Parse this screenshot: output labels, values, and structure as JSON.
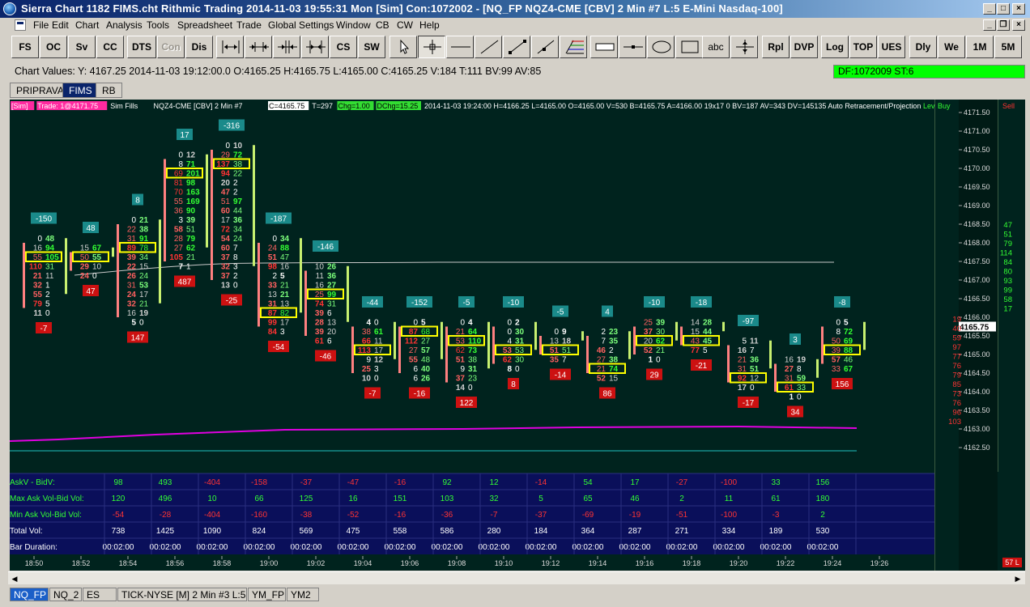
{
  "window": {
    "title": "Sierra Chart 1182 FIMS.cht  Rithmic Trading 2014-11-03  19:55:31 Mon [Sim]  Con:1072002 - [NQ_FP  NQZ4-CME [CBV]  2 Min   #7  L:5  E-Mini Nasdaq-100]",
    "minimize": "_",
    "maximize": "□",
    "close": "×",
    "restore": "❐"
  },
  "menu": [
    "File",
    "Edit",
    "Chart",
    "Analysis",
    "Tools",
    "Spreadsheet",
    "Trade",
    "Global Settings",
    "Window",
    "CB",
    "CW",
    "Help"
  ],
  "toolbar": {
    "buttons_left": [
      "FS",
      "OC",
      "Sv",
      "CC",
      "DTS",
      "Con",
      "Dis"
    ],
    "buttons_mid": [
      "CS",
      "SW"
    ],
    "text_tool": "abc",
    "buttons_right": [
      "Rpl",
      "DVP",
      "Log",
      "TOP",
      "UES",
      "Dly",
      "We",
      "1M",
      "5M"
    ],
    "icons": [
      "cursor-arrow-icon",
      "crosshair-icon",
      "horizontal-line-icon",
      "ray-icon",
      "line-icon",
      "extension-line-icon",
      "fibonacci-icon",
      "rectangle-highlight-icon",
      "marker-line-icon",
      "ellipse-icon",
      "rectangle-icon",
      "vertical-split-icon"
    ]
  },
  "values_bar": {
    "text": "Chart Values: Y: 4167.25  2014-11-03  19:12:00.0  O:4165.25  H:4165.75  L:4165.00  C:4165.25  V:184  T:111  BV:99  AV:85",
    "df_status": "DF:1072009  ST:6"
  },
  "chart_tabs": [
    {
      "label": "PRIPRAVA",
      "active": false
    },
    {
      "label": "FIMS",
      "active": true
    },
    {
      "label": "RB",
      "active": false
    }
  ],
  "chart_header": {
    "sim": "[Sim]",
    "trade": "Trade: 1@4171.75",
    "sim_fills": "Sim Fills",
    "symbol": "NQZ4-CME [CBV]  2 Min   #7",
    "close_val": "C=4165.75",
    "t_val": "T=297",
    "chg": "Chg=1.00",
    "dchg": "DChg=15.25",
    "info": "2014-11-03 19:24:00 H=4166.25 L=4165.00 O=4165.00 V=530 B=4165.75 A=4166.00 19x17 0 BV=187 AV=343 DV=145135  Auto Retracement/Projection",
    "lev": "Lev",
    "buy": "Buy",
    "sell": "Sell"
  },
  "price_axis": {
    "labels": [
      "4171.50",
      "4171.00",
      "4170.50",
      "4170.00",
      "4169.50",
      "4169.00",
      "4168.50",
      "4168.00",
      "4167.50",
      "4167.00",
      "4166.50",
      "4166.00",
      "4165.50",
      "4165.00",
      "4164.50",
      "4164.00",
      "4163.50",
      "4163.00",
      "4162.50"
    ],
    "current": "4165.75"
  },
  "time_axis": [
    "18:50",
    "18:52",
    "18:54",
    "18:56",
    "18:58",
    "19:00",
    "19:02",
    "19:04",
    "19:06",
    "19:08",
    "19:10",
    "19:12",
    "19:14",
    "19:16",
    "19:18",
    "19:20",
    "19:22",
    "19:24",
    "19:26"
  ],
  "dom": {
    "sell": [
      "19",
      "40",
      "59",
      "97",
      "77",
      "76",
      "79",
      "85",
      "73",
      "76",
      "96",
      "103"
    ],
    "buy": [
      "47",
      "51",
      "79",
      "114",
      "84",
      "80",
      "93",
      "99",
      "58",
      "17"
    ]
  },
  "footprint_bars": [
    {
      "delta_top": "-150",
      "delta_bottom": "-7",
      "rows": [
        [
          "0",
          "48"
        ],
        [
          "16",
          "94"
        ],
        [
          "55",
          "105"
        ],
        [
          "110",
          "31"
        ],
        [
          "21",
          "11"
        ],
        [
          "32",
          "1"
        ],
        [
          "55",
          "2"
        ],
        [
          "79",
          "5"
        ],
        [
          "11",
          "0"
        ]
      ]
    },
    {
      "delta_top": "48",
      "delta_bottom": "47",
      "rows": [
        [
          "15",
          "67"
        ],
        [
          "50",
          "55"
        ],
        [
          "29",
          "10"
        ],
        [
          "24",
          "0"
        ]
      ]
    },
    {
      "delta_top": "8",
      "delta_bottom": "147",
      "rows": [
        [
          "0",
          "21"
        ],
        [
          "22",
          "38"
        ],
        [
          "31",
          "91"
        ],
        [
          "89",
          "78"
        ],
        [
          "39",
          "34"
        ],
        [
          "22",
          "15"
        ],
        [
          "26",
          "24"
        ],
        [
          "31",
          "53"
        ],
        [
          "24",
          "17"
        ],
        [
          "32",
          "21"
        ],
        [
          "16",
          "19"
        ],
        [
          "5",
          "0"
        ]
      ]
    },
    {
      "delta_top": "17",
      "delta_bottom": "487",
      "rows": [
        [
          "0",
          "12"
        ],
        [
          "8",
          "71"
        ],
        [
          "69",
          "201"
        ],
        [
          "81",
          "98"
        ],
        [
          "70",
          "163"
        ],
        [
          "55",
          "169"
        ],
        [
          "36",
          "90"
        ],
        [
          "3",
          "39"
        ],
        [
          "58",
          "51"
        ],
        [
          "28",
          "79"
        ],
        [
          "27",
          "62"
        ],
        [
          "105",
          "21"
        ],
        [
          "7",
          "1"
        ]
      ]
    },
    {
      "delta_top": "-316",
      "delta_bottom": "-25",
      "rows": [
        [
          "0",
          "10"
        ],
        [
          "29",
          "72"
        ],
        [
          "137",
          "38"
        ],
        [
          "94",
          "22"
        ],
        [
          "20",
          "2"
        ],
        [
          "47",
          "2"
        ],
        [
          "51",
          "97"
        ],
        [
          "60",
          "44"
        ],
        [
          "17",
          "36"
        ],
        [
          "72",
          "34"
        ],
        [
          "54",
          "24"
        ],
        [
          "60",
          "7"
        ],
        [
          "37",
          "8"
        ],
        [
          "32",
          "3"
        ],
        [
          "37",
          "2"
        ],
        [
          "13",
          "0"
        ]
      ]
    },
    {
      "delta_top": "-187",
      "delta_bottom": "-54",
      "rows": [
        [
          "0",
          "34"
        ],
        [
          "24",
          "88"
        ],
        [
          "51",
          "47"
        ],
        [
          "98",
          "16"
        ],
        [
          "2",
          "5"
        ],
        [
          "33",
          "21"
        ],
        [
          "13",
          "21"
        ],
        [
          "31",
          "13"
        ],
        [
          "87",
          "82"
        ],
        [
          "99",
          "17"
        ],
        [
          "84",
          "3"
        ]
      ]
    },
    {
      "delta_top": "-146",
      "delta_bottom": "-46",
      "rows": [
        [
          "10",
          "26"
        ],
        [
          "11",
          "36"
        ],
        [
          "16",
          "27"
        ],
        [
          "25",
          "99"
        ],
        [
          "74",
          "31"
        ],
        [
          "39",
          "6"
        ],
        [
          "28",
          "13"
        ],
        [
          "39",
          "20"
        ],
        [
          "61",
          "6"
        ]
      ]
    },
    {
      "delta_top": "-44",
      "delta_bottom": "-7",
      "rows": [
        [
          "4",
          "0"
        ],
        [
          "38",
          "61"
        ],
        [
          "66",
          "11"
        ],
        [
          "113",
          "17"
        ],
        [
          "9",
          "12"
        ],
        [
          "25",
          "3"
        ],
        [
          "10",
          "0"
        ]
      ]
    },
    {
      "delta_top": "-152",
      "delta_bottom": "-16",
      "rows": [
        [
          "0",
          "5"
        ],
        [
          "87",
          "68"
        ],
        [
          "112",
          "27"
        ],
        [
          "27",
          "57"
        ],
        [
          "55",
          "48"
        ],
        [
          "6",
          "40"
        ],
        [
          "6",
          "26"
        ]
      ]
    },
    {
      "delta_top": "-5",
      "delta_bottom": "122",
      "rows": [
        [
          "0",
          "4"
        ],
        [
          "21",
          "64"
        ],
        [
          "53",
          "110"
        ],
        [
          "62",
          "73"
        ],
        [
          "51",
          "38"
        ],
        [
          "9",
          "31"
        ],
        [
          "37",
          "23"
        ],
        [
          "14",
          "0"
        ]
      ]
    },
    {
      "delta_top": "-10",
      "delta_bottom": "8",
      "rows": [
        [
          "0",
          "2"
        ],
        [
          "0",
          "30"
        ],
        [
          "4",
          "31"
        ],
        [
          "53",
          "53"
        ],
        [
          "62",
          "30"
        ],
        [
          "8",
          "0"
        ]
      ]
    },
    {
      "delta_top": "-5",
      "delta_bottom": "-14",
      "rows": [
        [
          "0",
          "9"
        ],
        [
          "13",
          "18"
        ],
        [
          "51",
          "51"
        ],
        [
          "35",
          "7"
        ]
      ]
    },
    {
      "delta_top": "4",
      "delta_bottom": "86",
      "rows": [
        [
          "2",
          "23"
        ],
        [
          "7",
          "35"
        ],
        [
          "46",
          "2"
        ],
        [
          "27",
          "38"
        ],
        [
          "21",
          "74"
        ],
        [
          "52",
          "15"
        ]
      ]
    },
    {
      "delta_top": "-10",
      "delta_bottom": "29",
      "rows": [
        [
          "25",
          "39"
        ],
        [
          "37",
          "30"
        ],
        [
          "20",
          "62"
        ],
        [
          "52",
          "21"
        ],
        [
          "1",
          "0"
        ]
      ]
    },
    {
      "delta_top": "-18",
      "delta_bottom": "-21",
      "rows": [
        [
          "14",
          "28"
        ],
        [
          "15",
          "44"
        ],
        [
          "43",
          "45"
        ],
        [
          "77",
          "5"
        ]
      ]
    },
    {
      "delta_top": "-97",
      "delta_bottom": "-17",
      "rows": [
        [
          "5",
          "11"
        ],
        [
          "16",
          "7"
        ],
        [
          "21",
          "36"
        ],
        [
          "31",
          "51"
        ],
        [
          "92",
          "12"
        ],
        [
          "17",
          "0"
        ]
      ]
    },
    {
      "delta_top": "3",
      "delta_bottom": "34",
      "rows": [
        [
          "16",
          "19"
        ],
        [
          "27",
          "8"
        ],
        [
          "31",
          "59"
        ],
        [
          "61",
          "33"
        ],
        [
          "1",
          "0"
        ]
      ]
    },
    {
      "delta_top": "-8",
      "delta_bottom": "156",
      "rows": [
        [
          "0",
          "5"
        ],
        [
          "8",
          "72"
        ],
        [
          "50",
          "69"
        ],
        [
          "39",
          "88"
        ],
        [
          "57",
          "46"
        ],
        [
          "33",
          "67"
        ]
      ]
    }
  ],
  "stats_table": {
    "rows": [
      {
        "label": "AskV - BidV:",
        "values": [
          "98",
          "493",
          "-404",
          "-158",
          "-37",
          "-47",
          "-16",
          "92",
          "12",
          "-14",
          "54",
          "17",
          "-27",
          "-100",
          "33",
          "156"
        ]
      },
      {
        "label": "Max Ask Vol-Bid Vol:",
        "values": [
          "120",
          "496",
          "10",
          "66",
          "125",
          "16",
          "151",
          "103",
          "32",
          "5",
          "65",
          "46",
          "2",
          "11",
          "61",
          "180"
        ]
      },
      {
        "label": "Min Ask Vol-Bid Vol:",
        "values": [
          "-54",
          "-28",
          "-404",
          "-160",
          "-38",
          "-52",
          "-16",
          "-36",
          "-7",
          "-37",
          "-69",
          "-19",
          "-51",
          "-100",
          "-3",
          "2"
        ]
      },
      {
        "label": "Total Vol:",
        "values": [
          "738",
          "1425",
          "1090",
          "824",
          "569",
          "475",
          "558",
          "586",
          "280",
          "184",
          "364",
          "287",
          "271",
          "334",
          "189",
          "530"
        ]
      },
      {
        "label": "Bar Duration:",
        "values": [
          "00:02:00",
          "00:02:00",
          "00:02:00",
          "00:02:00",
          "00:02:00",
          "00:02:00",
          "00:02:00",
          "00:02:00",
          "00:02:00",
          "00:02:00",
          "00:02:00",
          "00:02:00",
          "00:02:00",
          "00:02:00",
          "00:02:00",
          "00:02:00"
        ]
      }
    ]
  },
  "badge_57l": "57 L",
  "bottom_tabs": [
    {
      "label": "NQ_FP",
      "active": true
    },
    {
      "label": "NQ_2",
      "active": false
    },
    {
      "label": "ES",
      "active": false
    },
    {
      "label": "TICK-NYSE [M]  2 Min   #3  L:5",
      "active": false
    },
    {
      "label": "YM_FP",
      "active": false
    },
    {
      "label": "YM2",
      "active": false
    }
  ],
  "colors": {
    "chart_bg": "#00231e",
    "stats_bg": "#0a0f5a",
    "positive": "#33ff33",
    "negative": "#ff3333",
    "ask_hi": "#00ff00",
    "bid_hi": "#ff4040",
    "highlight_box": "#ffff00",
    "magenta": "#e000e0",
    "cyan": "#20c0c0",
    "delta_top_bg": "#1a8a8a",
    "delta_bottom_bg": "#cc1111"
  }
}
